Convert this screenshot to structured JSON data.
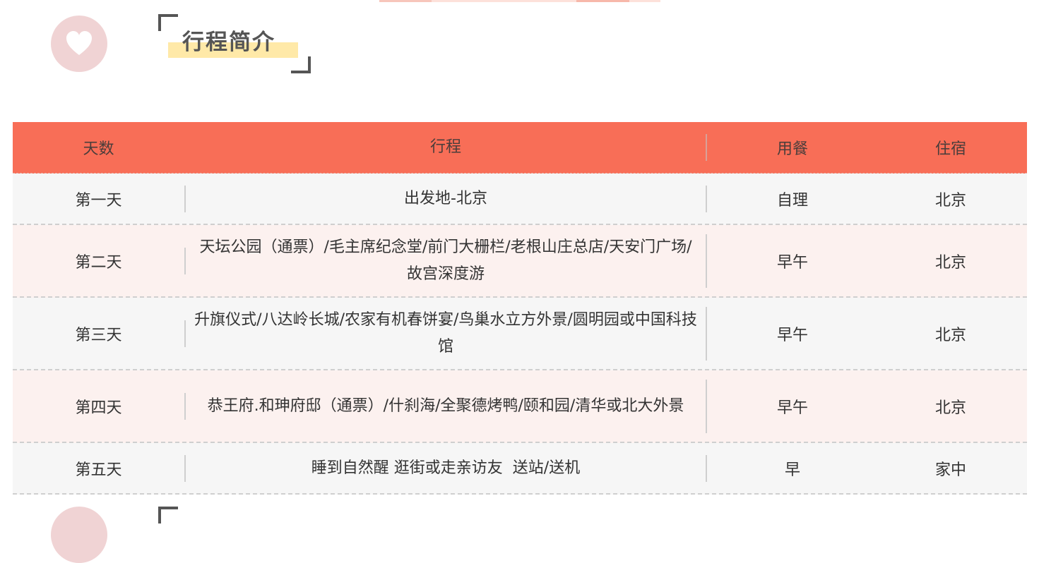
{
  "section": {
    "title": "行程简介"
  },
  "itinerary": {
    "headers": {
      "day": "天数",
      "route": "行程",
      "meal": "用餐",
      "stay": "住宿"
    },
    "rows": [
      {
        "day": "第一天",
        "route": "出发地-北京",
        "meal": "自理",
        "stay": "北京"
      },
      {
        "day": "第二天",
        "route": "天坛公园（通票）/毛主席纪念堂/前门大栅栏/老根山庄总店/天安门广场/故宫深度游",
        "meal": "早午",
        "stay": "北京"
      },
      {
        "day": "第三天",
        "route": "升旗仪式/八达岭长城/农家有机春饼宴/鸟巢水立方外景/圆明园或中国科技馆",
        "meal": "早午",
        "stay": "北京"
      },
      {
        "day": "第四天",
        "route": "恭王府.和珅府邸（通票）/什刹海/全聚德烤鸭/颐和园/清华或北大外景",
        "meal": "早午",
        "stay": "北京"
      },
      {
        "day": "第五天",
        "route": "睡到自然醒 逛街或走亲访友  送站/送机",
        "meal": "早",
        "stay": "家中"
      }
    ]
  },
  "colors": {
    "header_bg": "#f86e57",
    "row_grey": "#f6f6f6",
    "row_pink": "#fcf1ef",
    "badge": "#f0d3d4",
    "title_highlight": "#ffe9a8"
  },
  "icons": {
    "badge": "heart-icon"
  }
}
